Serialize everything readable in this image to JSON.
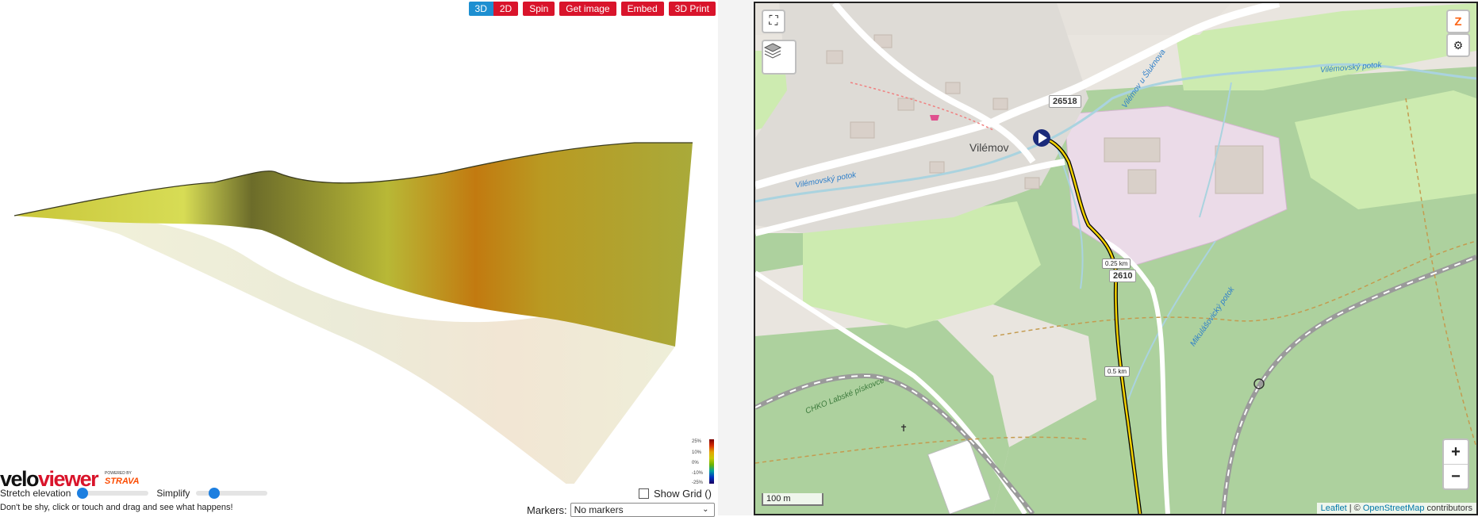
{
  "toolbar": {
    "btn_3d": "3D",
    "btn_2d": "2D",
    "spin": "Spin",
    "get_image": "Get image",
    "embed": "Embed",
    "print_3d": "3D Print"
  },
  "legend": {
    "labels": [
      "25%",
      "10%",
      "0%",
      "-10%",
      "-25%"
    ]
  },
  "branding": {
    "logo_a": "velo",
    "logo_b": "viewer",
    "powered": "POWERED BY",
    "strava": "STRAVA"
  },
  "controls": {
    "stretch_label": "Stretch elevation",
    "stretch_value": 0.1,
    "simplify_label": "Simplify",
    "simplify_value": 0.25,
    "show_grid": "Show Grid ()",
    "hint": "Don't be shy, click or touch and drag and see what happens!",
    "markers_label": "Markers:",
    "markers_value": "No markers"
  },
  "map": {
    "town": "Vilémov",
    "shield_1": "26518",
    "shield_2": "2610",
    "km_1": "0.25 km",
    "km_2": "0.5 km",
    "water_1": "Vilémovský potok",
    "water_2": "Vilémovský potok",
    "water_3": "Vilémov u Šluknova",
    "water_4": "Mikulášovický potok",
    "area": "CHKO Labské pískovce",
    "scale": "100 m",
    "attrib_leaflet": "Leaflet",
    "attrib_sep": " | © ",
    "attrib_osm": "OpenStreetMap",
    "attrib_contrib": " contributors",
    "zoom_in": "+",
    "zoom_out": "−"
  },
  "colors": {
    "accent": "#d9142b",
    "active": "#1d8fd1",
    "route": "#f2d100"
  }
}
